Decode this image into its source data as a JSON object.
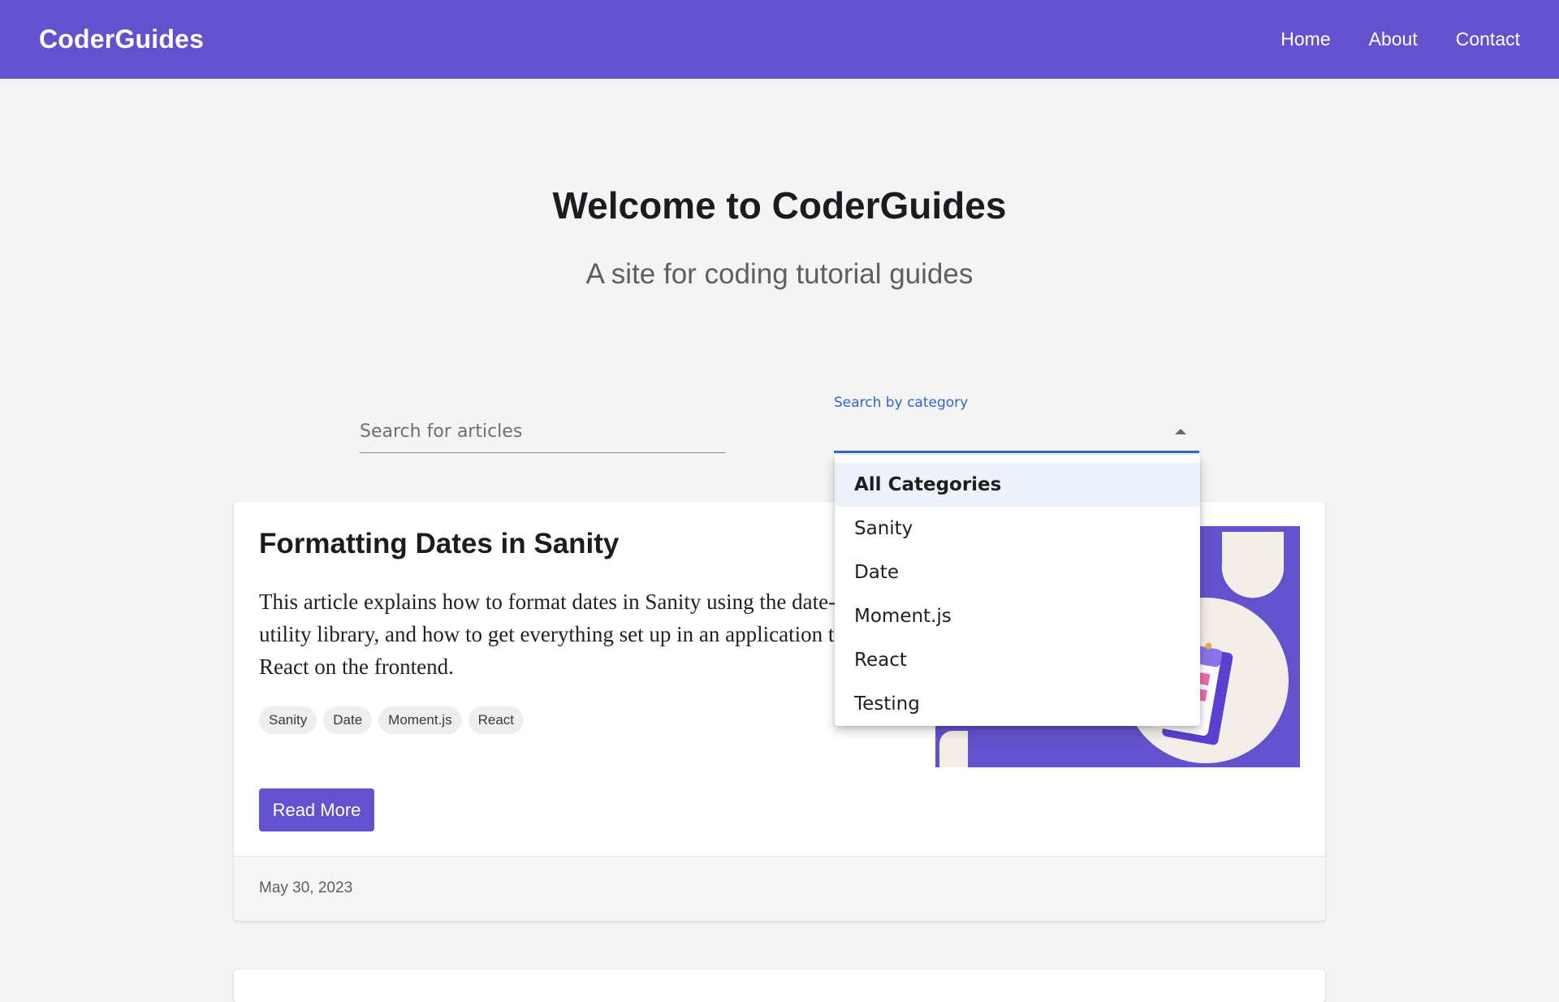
{
  "header": {
    "brand": "CoderGuides",
    "nav": [
      {
        "label": "Home"
      },
      {
        "label": "About"
      },
      {
        "label": "Contact"
      }
    ],
    "background_color": "#6451cd"
  },
  "hero": {
    "title": "Welcome to CoderGuides",
    "subtitle": "A site for coding tutorial guides"
  },
  "search": {
    "placeholder": "Search for articles",
    "value": ""
  },
  "category_filter": {
    "label": "Search by category",
    "selected": "All Categories",
    "open": true,
    "options": [
      {
        "label": "All Categories"
      },
      {
        "label": "Sanity"
      },
      {
        "label": "Date"
      },
      {
        "label": "Moment.js"
      },
      {
        "label": "React"
      },
      {
        "label": "Testing"
      }
    ],
    "accent_color": "#2c6bc7"
  },
  "articles": [
    {
      "title": "Formatting Dates in Sanity",
      "excerpt": "This article explains how to format dates in Sanity using the date-\nutility library, and how to get everything set up in an application t\nReact on the frontend.",
      "tags": [
        {
          "label": "Sanity"
        },
        {
          "label": "Date"
        },
        {
          "label": "Moment.js"
        },
        {
          "label": "React"
        }
      ],
      "read_more_label": "Read More",
      "date": "May 30, 2023",
      "image_icon": "calendar-illustration"
    }
  ]
}
